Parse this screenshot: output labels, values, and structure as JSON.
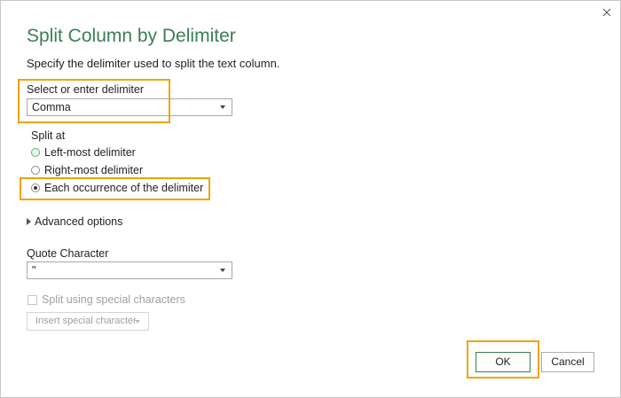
{
  "dialog": {
    "title": "Split Column by Delimiter",
    "subtitle": "Specify the delimiter used to split the text column.",
    "close_icon": "close-icon"
  },
  "delimiter": {
    "label": "Select or enter delimiter",
    "value": "Comma"
  },
  "split_at": {
    "label": "Split at",
    "options": [
      {
        "label": "Left-most delimiter",
        "checked": false
      },
      {
        "label": "Right-most delimiter",
        "checked": false
      },
      {
        "label": "Each occurrence of the delimiter",
        "checked": true
      }
    ]
  },
  "advanced": {
    "label": "Advanced options"
  },
  "quote": {
    "label": "Quote Character",
    "value": "\""
  },
  "special": {
    "checkbox_label": "Split using special characters",
    "insert_label": "Insert special character"
  },
  "buttons": {
    "ok": "OK",
    "cancel": "Cancel"
  },
  "colors": {
    "title": "#3c7d55",
    "highlight": "#f0a30a",
    "ok_border": "#3c7d55"
  }
}
